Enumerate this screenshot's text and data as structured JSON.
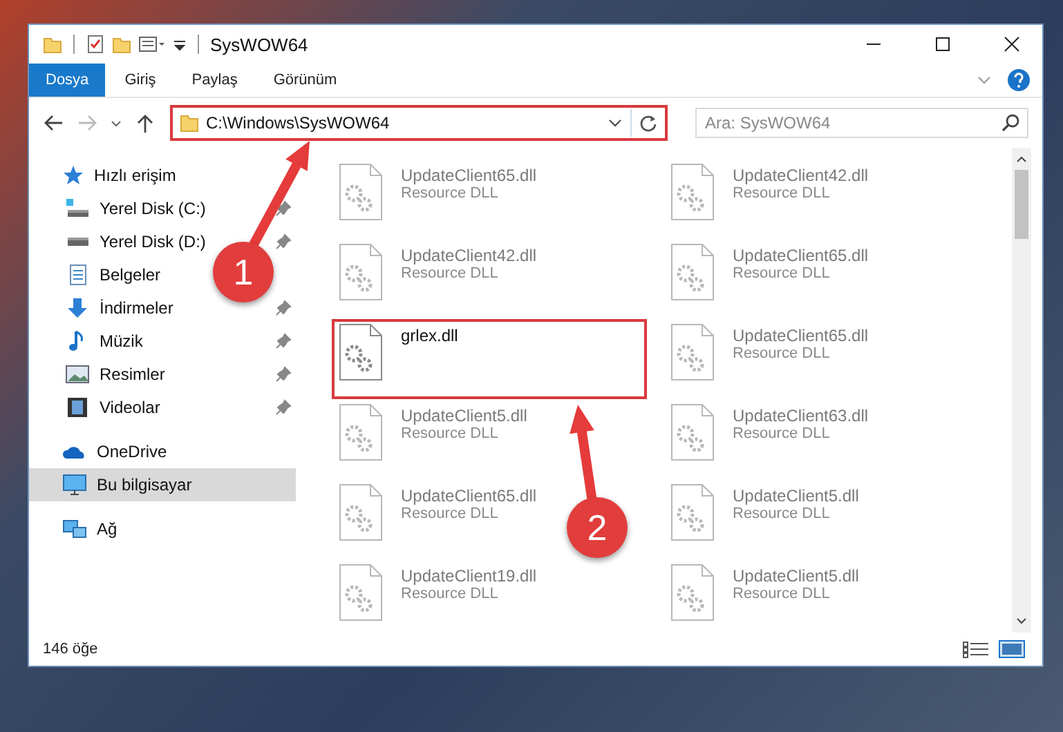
{
  "window": {
    "title": "SysWOW64"
  },
  "ribbon_tabs": [
    {
      "label": "Dosya",
      "selected": true
    },
    {
      "label": "Giriş",
      "selected": false
    },
    {
      "label": "Paylaş",
      "selected": false
    },
    {
      "label": "Görünüm",
      "selected": false
    }
  ],
  "address": {
    "path": "C:\\Windows\\SysWOW64",
    "highlighted": true
  },
  "search": {
    "placeholder": "Ara: SysWOW64"
  },
  "sidebar": {
    "items": [
      {
        "label": "Hızlı erişim",
        "kind": "star",
        "selected": false,
        "children": [
          {
            "label": "Yerel Disk (C:)",
            "kind": "drive-c",
            "pinned": true,
            "selected": false
          },
          {
            "label": "Yerel Disk (D:)",
            "kind": "drive",
            "pinned": true,
            "selected": false
          },
          {
            "label": "Belgeler",
            "kind": "docs",
            "pinned": false,
            "selected": false
          },
          {
            "label": "İndirmeler",
            "kind": "download",
            "pinned": true,
            "selected": false
          },
          {
            "label": "Müzik",
            "kind": "music",
            "pinned": true,
            "selected": false
          },
          {
            "label": "Resimler",
            "kind": "pictures",
            "pinned": true,
            "selected": false
          },
          {
            "label": "Videolar",
            "kind": "video",
            "pinned": true,
            "selected": false
          }
        ]
      },
      {
        "label": "OneDrive",
        "kind": "cloud",
        "selected": false
      },
      {
        "label": "Bu bilgisayar",
        "kind": "pc",
        "selected": true
      },
      {
        "label": "Ağ",
        "kind": "network",
        "selected": false
      }
    ]
  },
  "files": [
    {
      "name": "UpdateClient65.dll",
      "type": "Resource DLL",
      "faded": true,
      "highlighted": false
    },
    {
      "name": "UpdateClient42.dll",
      "type": "Resource DLL",
      "faded": true,
      "highlighted": false
    },
    {
      "name": "UpdateClient42.dll",
      "type": "Resource DLL",
      "faded": true,
      "highlighted": false
    },
    {
      "name": "UpdateClient65.dll",
      "type": "Resource DLL",
      "faded": true,
      "highlighted": false
    },
    {
      "name": "grlex.dll",
      "faded": false,
      "highlighted": true
    },
    {
      "name": "UpdateClient65.dll",
      "type": "Resource DLL",
      "faded": true,
      "highlighted": false
    },
    {
      "name": "UpdateClient5.dll",
      "type": "Resource DLL",
      "faded": true,
      "highlighted": false
    },
    {
      "name": "UpdateClient63.dll",
      "type": "Resource DLL",
      "faded": true,
      "highlighted": false
    },
    {
      "name": "UpdateClient65.dll",
      "type": "Resource DLL",
      "faded": true,
      "highlighted": false
    },
    {
      "name": "UpdateClient5.dll",
      "type": "Resource DLL",
      "faded": true,
      "highlighted": false
    },
    {
      "name": "UpdateClient19.dll",
      "type": "Resource DLL",
      "faded": true,
      "highlighted": false
    },
    {
      "name": "UpdateClient5.dll",
      "type": "Resource DLL",
      "faded": true,
      "highlighted": false
    }
  ],
  "status_bar": {
    "count": "146 öğe"
  },
  "annotations": [
    {
      "label": "1"
    },
    {
      "label": "2"
    }
  ]
}
